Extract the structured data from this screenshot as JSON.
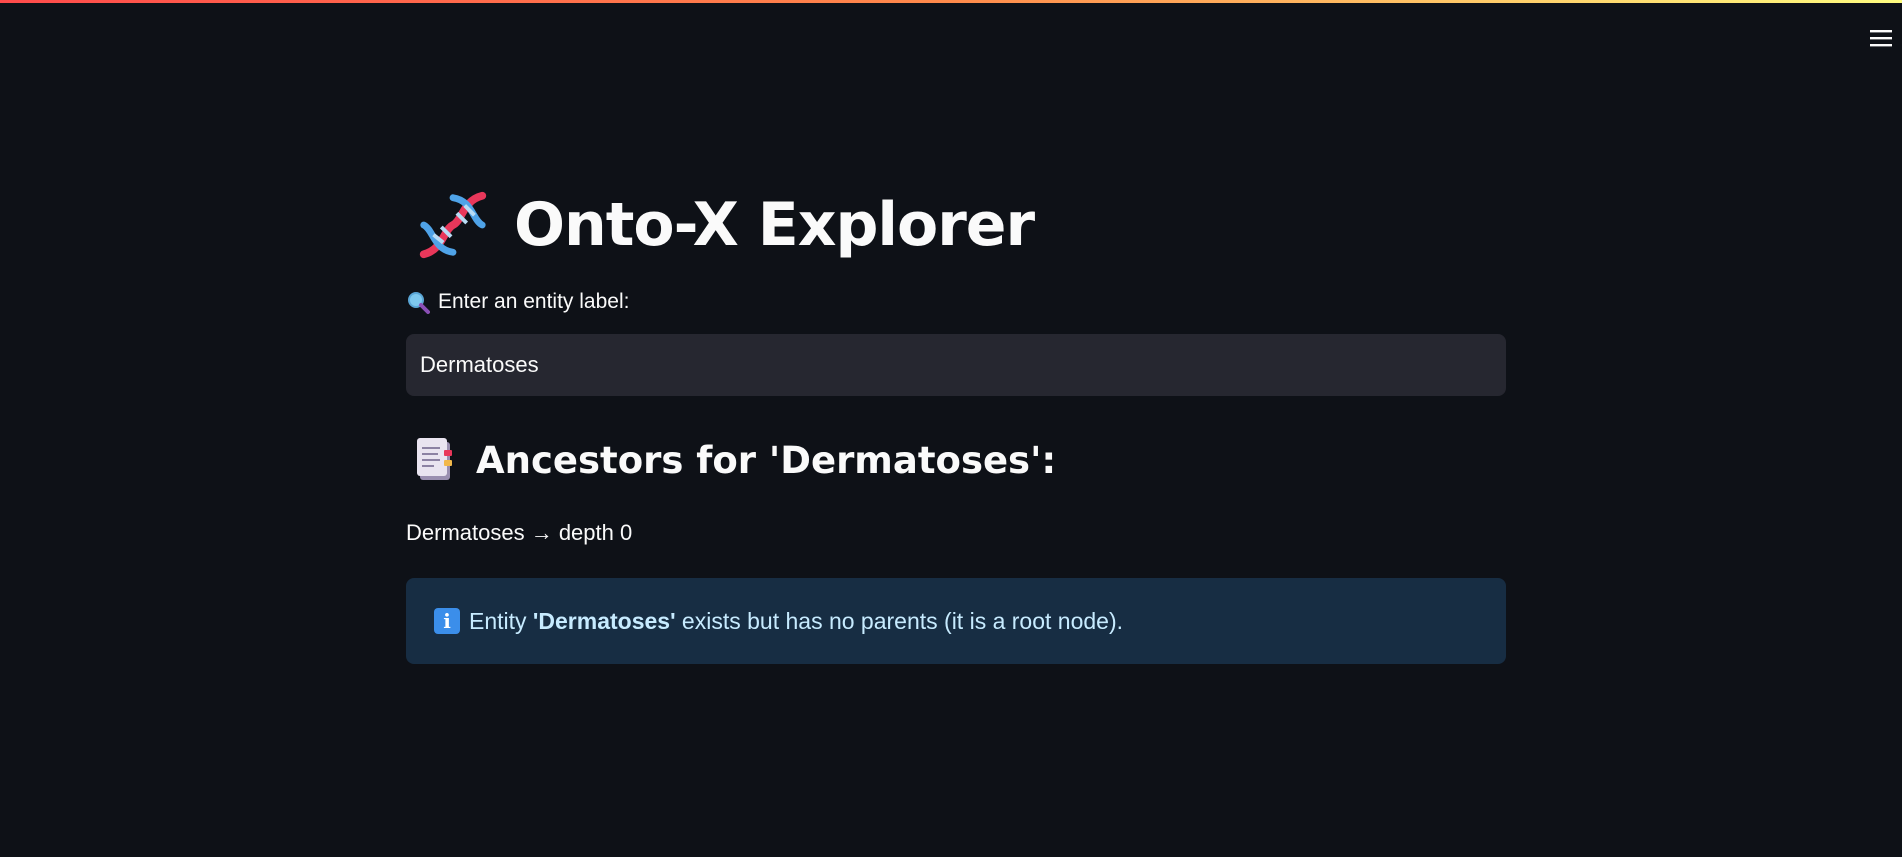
{
  "app": {
    "title": "Onto-X Explorer"
  },
  "search": {
    "label": "Enter an entity label:",
    "value": "Dermatoses"
  },
  "results": {
    "heading": "Ancestors for 'Dermatoses':",
    "depth_line": "Dermatoses → depth 0"
  },
  "info": {
    "prefix": "Entity ",
    "entity": "'Dermatoses'",
    "suffix": " exists but has no parents (it is a root node)."
  },
  "icons": {
    "title": "dna-icon",
    "label": "magnifying-glass-icon",
    "heading": "document-icon",
    "info": "information-icon",
    "menu": "hamburger-menu-icon"
  },
  "colors": {
    "background": "#0e1117",
    "input_bg": "#262730",
    "info_bg": "#172d43",
    "info_text": "#c7ebff",
    "accent_start": "#ff4b4b",
    "accent_end": "#fffd80"
  }
}
